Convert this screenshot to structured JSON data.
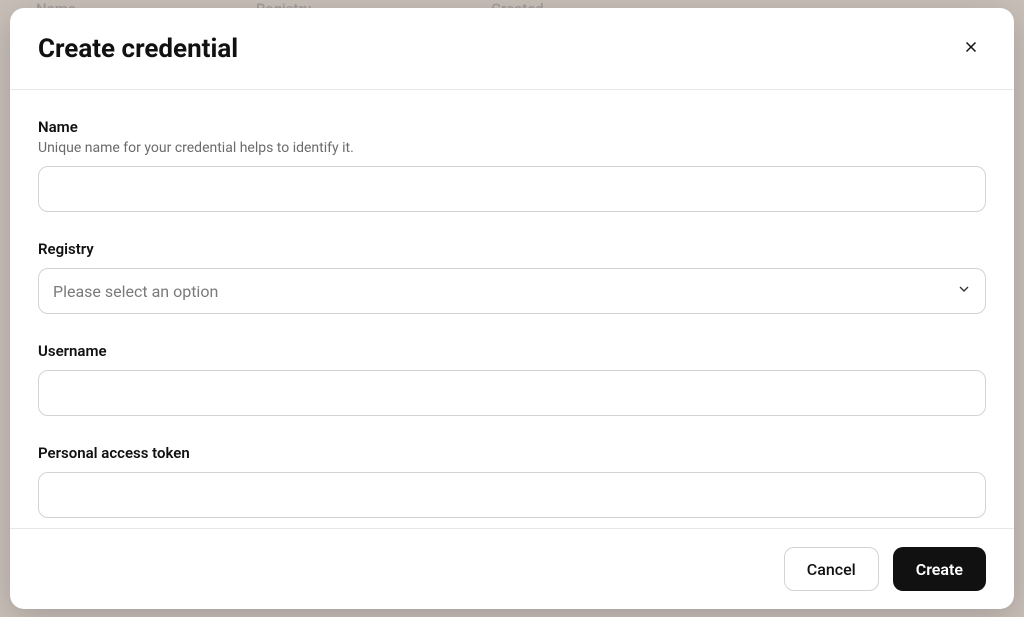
{
  "background": {
    "columns": [
      "Name",
      "Registry",
      "Created"
    ]
  },
  "modal": {
    "title": "Create credential",
    "fields": {
      "name": {
        "label": "Name",
        "description": "Unique name for your credential helps to identify it.",
        "value": ""
      },
      "registry": {
        "label": "Registry",
        "placeholder": "Please select an option",
        "value": ""
      },
      "username": {
        "label": "Username",
        "value": ""
      },
      "token": {
        "label": "Personal access token",
        "value": ""
      }
    },
    "actions": {
      "cancel": "Cancel",
      "create": "Create"
    }
  }
}
